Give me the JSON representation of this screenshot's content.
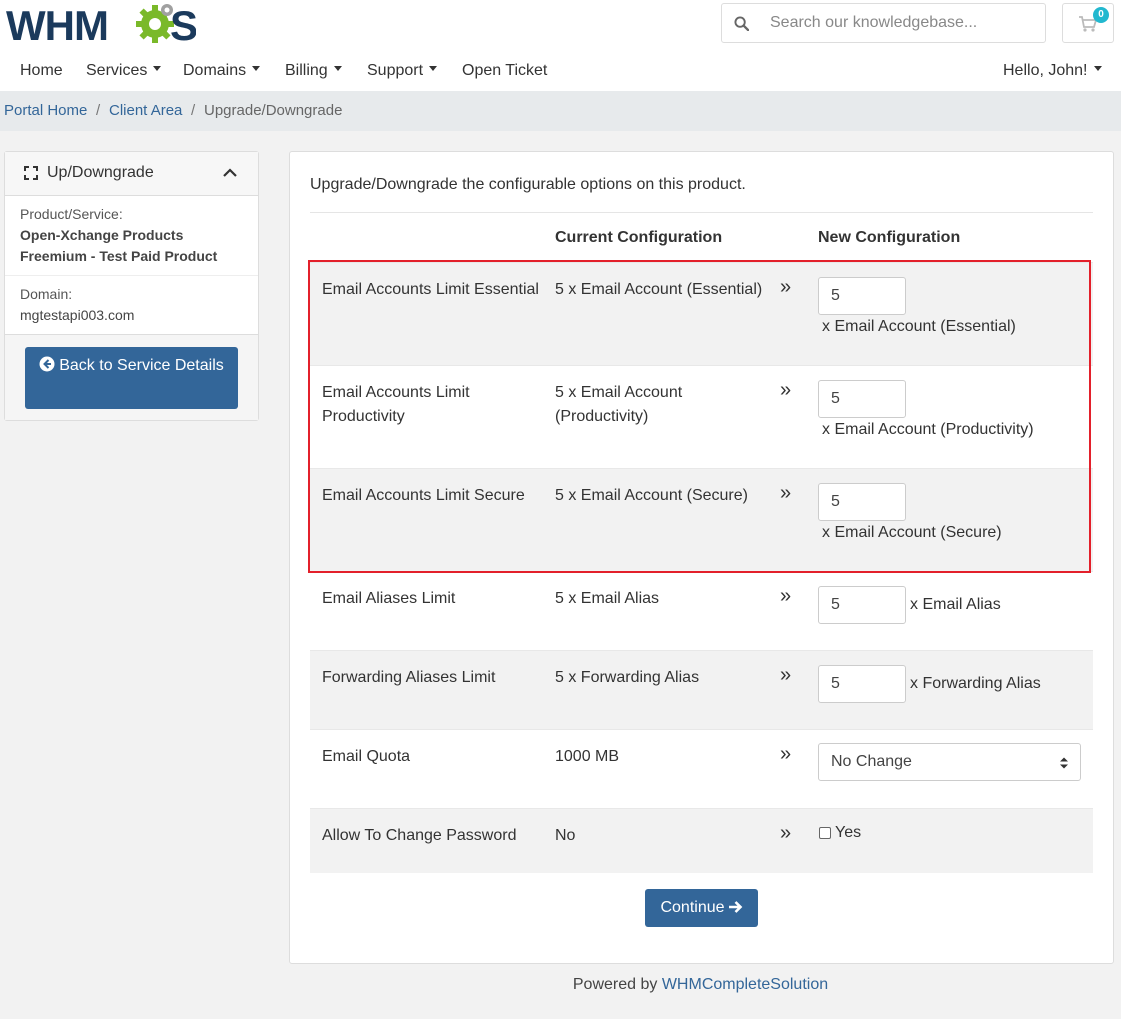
{
  "brand": {
    "logo_text_left": "WHM",
    "logo_text_right": "S"
  },
  "colors": {
    "primary": "#336699",
    "highlight": "#e3202b",
    "badge": "#22b8cf"
  },
  "search": {
    "placeholder": "Search our knowledgebase..."
  },
  "cart": {
    "count": "0",
    "icon": "shopping-cart-icon"
  },
  "nav": {
    "home": "Home",
    "services": "Services",
    "domains": "Domains",
    "billing": "Billing",
    "support": "Support",
    "open_ticket": "Open Ticket",
    "user": "Hello, John!"
  },
  "breadcrumb": [
    "Portal Home",
    "Client Area",
    "Upgrade/Downgrade"
  ],
  "sidebar": {
    "title": "Up/Downgrade",
    "product_label": "Product/Service:",
    "product_line1": "Open-Xchange Products",
    "product_line2": "Freemium - Test Paid Product",
    "domain_label": "Domain:",
    "domain_value": "mgtestapi003.com",
    "back_button": "Back to Service Details"
  },
  "main": {
    "intro": "Upgrade/Downgrade the configurable options on this product.",
    "col_current": "Current Configuration",
    "col_new": "New Configuration",
    "arrow": "»",
    "rows": [
      {
        "name": "Email Accounts Limit Essential",
        "current": "5 x Email Account (Essential)",
        "value": "5",
        "unit": "x Email Account (Essential)"
      },
      {
        "name": "Email Accounts Limit Productivity",
        "current": "5 x Email Account (Productivity)",
        "value": "5",
        "unit": "x Email Account (Productivity)"
      },
      {
        "name": "Email Accounts Limit Secure",
        "current": "5 x Email Account (Secure)",
        "value": "5",
        "unit": "x Email Account (Secure)"
      },
      {
        "name": "Email Aliases Limit",
        "current": "5 x Email Alias",
        "value": "5",
        "unit": "x Email Alias"
      },
      {
        "name": "Forwarding Aliases Limit",
        "current": "5 x Forwarding Alias",
        "value": "5",
        "unit": "x Forwarding Alias"
      },
      {
        "name": "Email Quota",
        "current": "1000 MB",
        "select": "No Change"
      },
      {
        "name": "Allow To Change Password",
        "current": "No",
        "checkbox_label": "Yes"
      }
    ],
    "continue": "Continue"
  },
  "footer": {
    "prefix": "Powered by",
    "link": "WHMCompleteSolution"
  }
}
